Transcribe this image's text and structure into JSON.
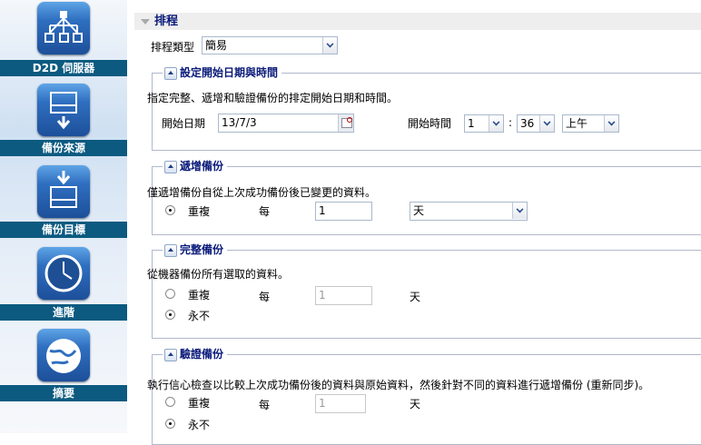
{
  "sidebar": {
    "items": [
      {
        "label": "D2D 伺服器",
        "icon": "server-tree-icon"
      },
      {
        "label": "備份來源",
        "icon": "drive-upload-icon"
      },
      {
        "label": "備份目標",
        "icon": "drive-download-icon"
      },
      {
        "label": "進階",
        "icon": "clock-icon"
      },
      {
        "label": "摘要",
        "icon": "globe-icon"
      }
    ]
  },
  "schedule": {
    "title": "排程",
    "type_label": "排程類型",
    "type_value": "簡易"
  },
  "start": {
    "legend": "設定開始日期與時間",
    "desc": "指定完整、遞增和驗證備份的排定開始日期和時間。",
    "date_label": "開始日期",
    "date_value": "13/7/3",
    "time_label": "開始時間",
    "hour": "1",
    "colon": ":",
    "minute": "36",
    "ampm": "上午"
  },
  "incremental": {
    "legend": "遞增備份",
    "desc": "僅遞增備份自從上次成功備份後已變更的資料。",
    "repeat_label": "重複",
    "every_label": "每",
    "interval": "1",
    "unit": "天"
  },
  "full": {
    "legend": "完整備份",
    "desc": "從機器備份所有選取的資料。",
    "repeat_label": "重複",
    "every_label": "每",
    "interval": "1",
    "unit": "天",
    "never_label": "永不"
  },
  "verify": {
    "legend": "驗證備份",
    "desc": "執行信心檢查以比較上次成功備份後的資料與原始資料，然後針對不同的資料進行遞增備份 (重新同步)。",
    "repeat_label": "重複",
    "every_label": "每",
    "interval": "1",
    "unit": "天",
    "never_label": "永不"
  }
}
